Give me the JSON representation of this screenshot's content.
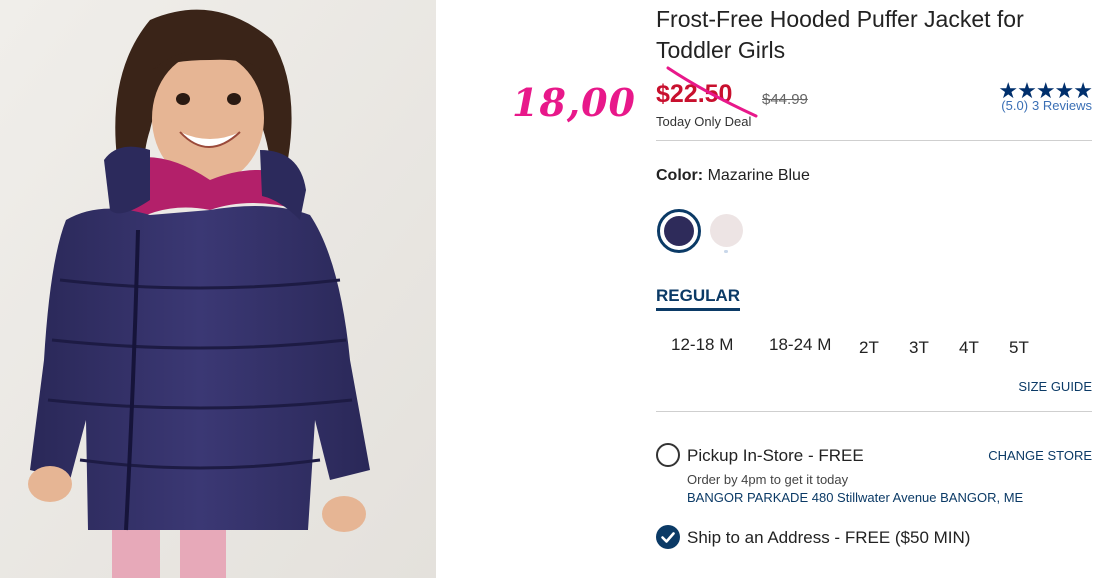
{
  "annotation": {
    "text": "18,00",
    "color": "#e8188a"
  },
  "product": {
    "title": "Frost-Free Hooded Puffer Jacket for Toddler Girls",
    "price_now": "$22.50",
    "price_was": "$44.99",
    "deal_label": "Today Only Deal",
    "price_color": "#c8102e"
  },
  "rating": {
    "stars": "★★★★★",
    "score": "(5.0)",
    "reviews": "3 Reviews",
    "stars_value": 5.0
  },
  "color": {
    "label": "Color:",
    "value": "Mazarine Blue",
    "swatches": [
      {
        "name": "Mazarine Blue",
        "hex": "#2e2b5a",
        "selected": true
      },
      {
        "name": "light pink",
        "hex": "#ede4e4",
        "selected": false
      }
    ]
  },
  "fit": {
    "tab": "REGULAR"
  },
  "sizes": [
    "12-18 M",
    "18-24 M",
    "2T",
    "3T",
    "4T",
    "5T"
  ],
  "size_guide": "SIZE GUIDE",
  "pickup": {
    "label": "Pickup In-Store - FREE",
    "note": "Order by 4pm to get it today",
    "address": "BANGOR PARKADE 480 Stillwater Avenue  BANGOR, ME",
    "change": "CHANGE STORE",
    "selected": false
  },
  "ship": {
    "label": "Ship to an Address - FREE ($50 MIN)",
    "selected": true
  },
  "colors": {
    "brand_navy": "#0b3a66",
    "star_navy": "#002f6c"
  }
}
